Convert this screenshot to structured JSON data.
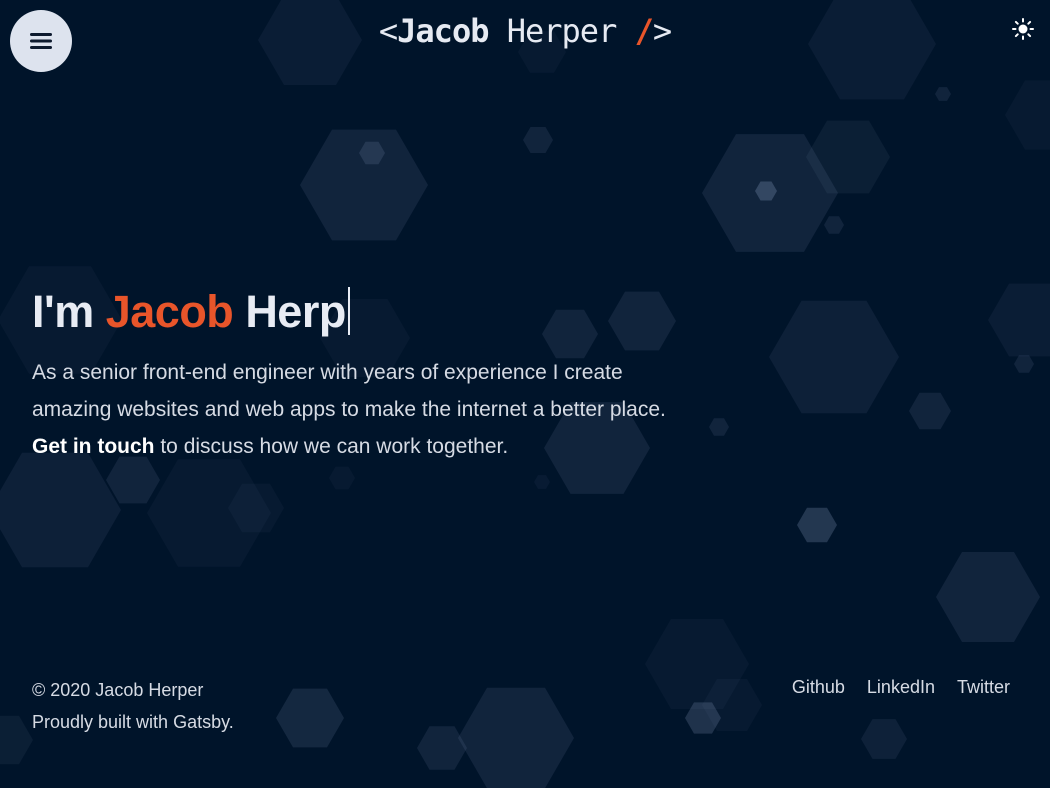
{
  "header": {
    "logo": {
      "open": "<",
      "first": "Jacob",
      "last": "Herper",
      "slash": "/",
      "close": ">"
    },
    "menu_icon": "hamburger-icon",
    "theme_icon": "sun-icon"
  },
  "hero": {
    "greeting": "I'm",
    "name_first": "Jacob",
    "name_last": "Herp",
    "intro": "As a senior front-end engineer with years of experience I create amazing websites and web apps to make the internet a better place.",
    "cta": "Get in touch",
    "outro": "to discuss how we can work together."
  },
  "footer": {
    "copyright": "© 2020 Jacob Herper",
    "built_with": "Proudly built with Gatsby.",
    "links": [
      "Github",
      "LinkedIn",
      "Twitter"
    ]
  },
  "colors": {
    "background": "#00142a",
    "accent": "#e8552a",
    "text": "#dfe3ea"
  }
}
